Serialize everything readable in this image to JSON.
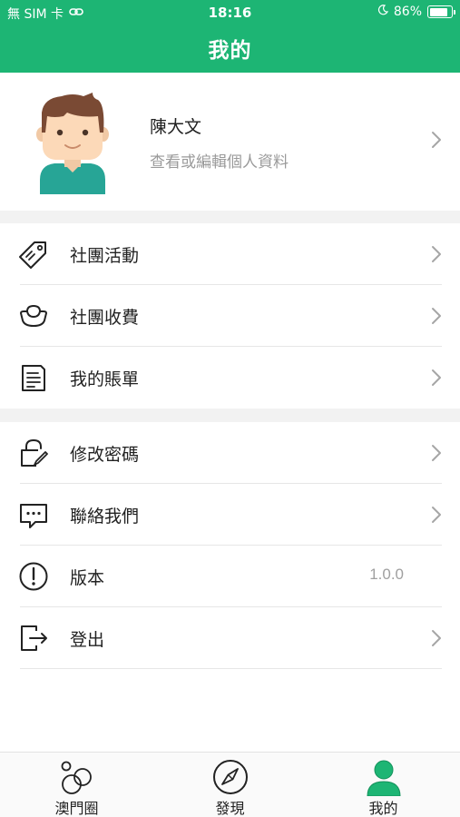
{
  "status_bar": {
    "carrier": "無 SIM 卡",
    "time": "18:16",
    "battery": "86%",
    "battery_level": 0.86
  },
  "header": {
    "title": "我的"
  },
  "profile": {
    "name": "陳大文",
    "subtitle": "查看或編輯個人資料",
    "avatar_icon": "male-avatar-icon"
  },
  "menu_group_1": [
    {
      "label": "社團活動",
      "icon": "price-tag-icon"
    },
    {
      "label": "社團收費",
      "icon": "gold-ingot-icon"
    },
    {
      "label": "我的賬單",
      "icon": "bill-document-icon"
    }
  ],
  "menu_group_2": [
    {
      "label": "修改密碼",
      "icon": "lock-edit-icon"
    },
    {
      "label": "聯絡我們",
      "icon": "chat-bubble-icon"
    },
    {
      "label": "版本",
      "icon": "info-circle-icon",
      "value": "1.0.0"
    },
    {
      "label": "登出",
      "icon": "logout-icon"
    }
  ],
  "tabbar": {
    "tabs": [
      {
        "label": "澳門圈",
        "icon": "circles-icon"
      },
      {
        "label": "發現",
        "icon": "compass-icon"
      },
      {
        "label": "我的",
        "icon": "user-icon",
        "active": true
      }
    ]
  },
  "colors": {
    "accent": "#1db574",
    "tab_active": "#1db574",
    "text": "#222222",
    "muted": "#9a9a9a",
    "background_gap": "#f2f2f2"
  }
}
